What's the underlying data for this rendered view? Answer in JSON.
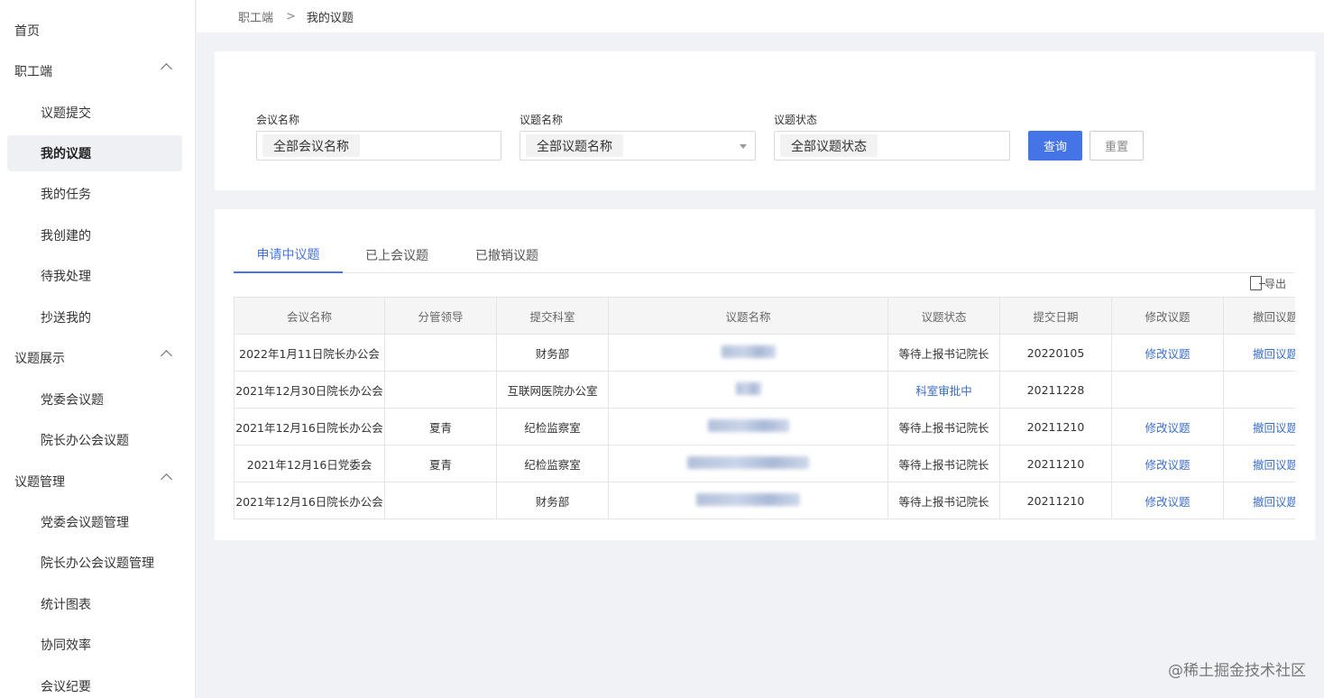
{
  "sidebar": {
    "items": [
      {
        "label": "首页",
        "level": "top"
      },
      {
        "label": "职工端",
        "level": "top",
        "expanded": true
      },
      {
        "label": "议题提交",
        "level": "sub"
      },
      {
        "label": "我的议题",
        "level": "sub",
        "active": true
      },
      {
        "label": "我的任务",
        "level": "sub"
      },
      {
        "label": "我创建的",
        "level": "sub"
      },
      {
        "label": "待我处理",
        "level": "sub"
      },
      {
        "label": "抄送我的",
        "level": "sub"
      },
      {
        "label": "议题展示",
        "level": "top",
        "expanded": true
      },
      {
        "label": "党委会议题",
        "level": "sub"
      },
      {
        "label": "院长办公会议题",
        "level": "sub"
      },
      {
        "label": "议题管理",
        "level": "top",
        "expanded": true
      },
      {
        "label": "党委会议题管理",
        "level": "sub"
      },
      {
        "label": "院长办公会议题管理",
        "level": "sub"
      },
      {
        "label": "统计图表",
        "level": "sub"
      },
      {
        "label": "协同效率",
        "level": "sub"
      },
      {
        "label": "会议纪要",
        "level": "sub"
      }
    ]
  },
  "breadcrumb": {
    "parent": "职工端",
    "separator": ">",
    "current": "我的议题"
  },
  "filters": {
    "meeting_name": {
      "label": "会议名称",
      "value": "全部会议名称"
    },
    "topic_name": {
      "label": "议题名称",
      "value": "全部议题名称"
    },
    "topic_status": {
      "label": "议题状态",
      "value": "全部议题状态"
    },
    "query_label": "查询",
    "reset_label": "重置"
  },
  "tabs": [
    {
      "label": "申请中议题",
      "active": true
    },
    {
      "label": "已上会议题",
      "active": false
    },
    {
      "label": "已撤销议题",
      "active": false
    }
  ],
  "export_label": "导出",
  "table": {
    "columns": [
      "会议名称",
      "分管领导",
      "提交科室",
      "议题名称",
      "议题状态",
      "提交日期",
      "修改议题",
      "撤回议题"
    ],
    "rows": [
      {
        "meeting": "2022年1月11日院长办公会",
        "leader": "",
        "dept": "财务部",
        "status": "等待上报书记院长",
        "status_link": false,
        "date": "20220105",
        "edit": "修改议题",
        "withdraw": "撤回议题"
      },
      {
        "meeting": "2021年12月30日院长办公会",
        "leader": "",
        "dept": "互联网医院办公室",
        "status": "科室审批中",
        "status_link": true,
        "date": "20211228",
        "edit": "",
        "withdraw": ""
      },
      {
        "meeting": "2021年12月16日院长办公会",
        "leader": "夏青",
        "dept": "纪检监察室",
        "status": "等待上报书记院长",
        "status_link": false,
        "date": "20211210",
        "edit": "修改议题",
        "withdraw": "撤回议题"
      },
      {
        "meeting": "2021年12月16日党委会",
        "leader": "夏青",
        "dept": "纪检监察室",
        "status": "等待上报书记院长",
        "status_link": false,
        "date": "20211210",
        "edit": "修改议题",
        "withdraw": "撤回议题"
      },
      {
        "meeting": "2021年12月16日院长办公会",
        "leader": "",
        "dept": "财务部",
        "status": "等待上报书记院长",
        "status_link": false,
        "date": "20211210",
        "edit": "修改议题",
        "withdraw": "撤回议题"
      }
    ]
  },
  "watermark": "@稀土掘金技术社区",
  "colors": {
    "accent": "#4574e6",
    "link": "#3a6ec9"
  },
  "icons": {
    "expand": "chevron-up-icon",
    "export": "export-file-icon",
    "select": "caret-down-icon"
  }
}
